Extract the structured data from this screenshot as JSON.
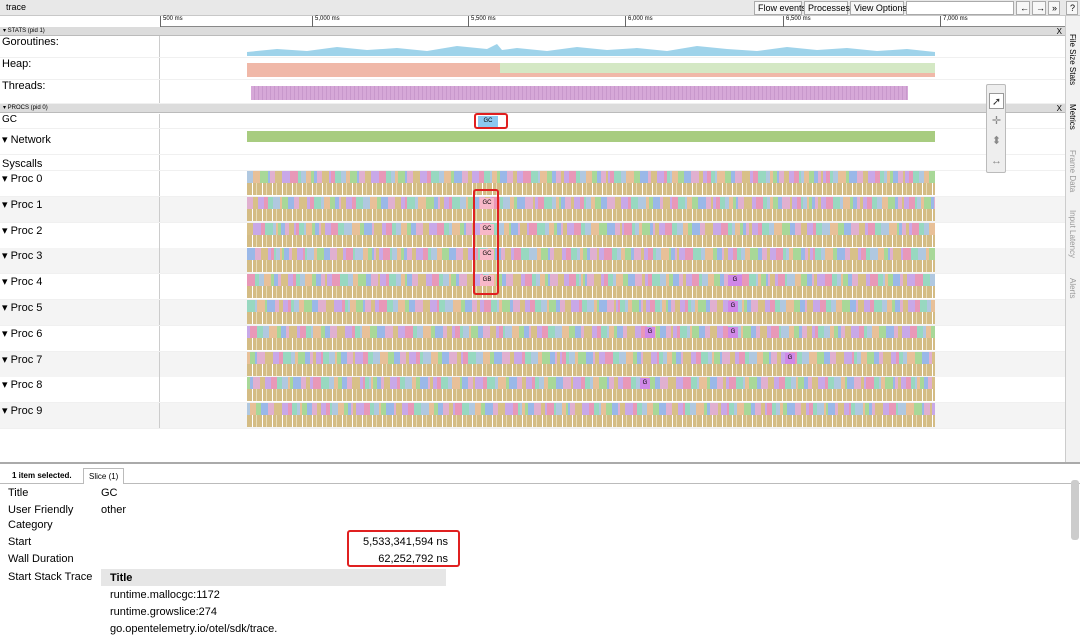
{
  "app": {
    "title": "trace"
  },
  "toolbar": {
    "flow_events": "Flow events",
    "processes": "Processes",
    "view_options": "View Options",
    "back": "←",
    "fwd": "→",
    "more": "»",
    "help": "?"
  },
  "ruler": {
    "ticks": [
      "500 ms",
      "5,000 ms",
      "5,500 ms",
      "6,000 ms",
      "6,500 ms",
      "7,000 ms"
    ]
  },
  "stats": {
    "header": "▾ STATS (pid 1)",
    "close": "X",
    "rows": [
      "Goroutines:",
      "Heap:",
      "Threads:"
    ]
  },
  "procs": {
    "header": "▾ PROCS (pid 0)",
    "close": "X",
    "gc_label": "GC",
    "gc_box": "GC",
    "network": "▾  Network",
    "syscalls": "Syscalls",
    "procs": [
      "▾  Proc 0",
      "▾  Proc 1",
      "▾  Proc 2",
      "▾  Proc 3",
      "▾  Proc 4",
      "▾  Proc 5",
      "▾  Proc 6",
      "▾  Proc 7",
      "▾  Proc 8",
      "▾  Proc 9"
    ],
    "gc_marks": [
      "GC",
      "GC",
      "GC",
      "GB",
      "G",
      "G",
      "G",
      "G",
      "G"
    ]
  },
  "side_tabs": [
    "File Size Stats",
    "Metrics",
    "Frame Data",
    "Input Latency",
    "Alerts"
  ],
  "tools": [
    "pointer-tool",
    "pan-tool",
    "zoom-tool",
    "timing-tool"
  ],
  "panel": {
    "selected": "1 item selected.",
    "tab": "Slice (1)",
    "fields": {
      "title_label": "Title",
      "title_value": "GC",
      "cat_label1": "User Friendly",
      "cat_label2": "Category",
      "cat_value": "other",
      "start_label": "Start",
      "start_value": "5,533,341,594 ns",
      "wall_label": "Wall Duration",
      "wall_value": "62,252,792 ns",
      "stack_label": "Start Stack Trace",
      "stack_header": "Title"
    },
    "frames": [
      "runtime.mallocgc:1172",
      "runtime.growslice:274",
      "go.opentelemetry.io/otel/sdk/trace."
    ]
  },
  "colors": {
    "goroutines": "#9fd3ea",
    "heap_a": "#f0b8a8",
    "heap_b": "#d4e8c4",
    "threads": "#d6a8d8",
    "network": "#a8cc80",
    "gc": "#8cc8f0",
    "highlight": "#e02020"
  }
}
